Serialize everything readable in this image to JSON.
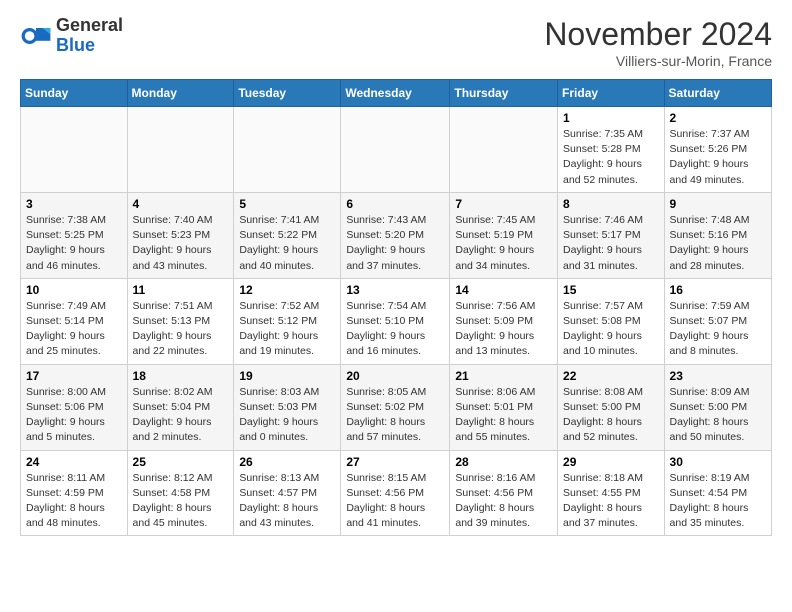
{
  "logo": {
    "text_general": "General",
    "text_blue": "Blue"
  },
  "title": "November 2024",
  "location": "Villiers-sur-Morin, France",
  "weekdays": [
    "Sunday",
    "Monday",
    "Tuesday",
    "Wednesday",
    "Thursday",
    "Friday",
    "Saturday"
  ],
  "weeks": [
    [
      {
        "day": "",
        "info": ""
      },
      {
        "day": "",
        "info": ""
      },
      {
        "day": "",
        "info": ""
      },
      {
        "day": "",
        "info": ""
      },
      {
        "day": "",
        "info": ""
      },
      {
        "day": "1",
        "info": "Sunrise: 7:35 AM\nSunset: 5:28 PM\nDaylight: 9 hours\nand 52 minutes."
      },
      {
        "day": "2",
        "info": "Sunrise: 7:37 AM\nSunset: 5:26 PM\nDaylight: 9 hours\nand 49 minutes."
      }
    ],
    [
      {
        "day": "3",
        "info": "Sunrise: 7:38 AM\nSunset: 5:25 PM\nDaylight: 9 hours\nand 46 minutes."
      },
      {
        "day": "4",
        "info": "Sunrise: 7:40 AM\nSunset: 5:23 PM\nDaylight: 9 hours\nand 43 minutes."
      },
      {
        "day": "5",
        "info": "Sunrise: 7:41 AM\nSunset: 5:22 PM\nDaylight: 9 hours\nand 40 minutes."
      },
      {
        "day": "6",
        "info": "Sunrise: 7:43 AM\nSunset: 5:20 PM\nDaylight: 9 hours\nand 37 minutes."
      },
      {
        "day": "7",
        "info": "Sunrise: 7:45 AM\nSunset: 5:19 PM\nDaylight: 9 hours\nand 34 minutes."
      },
      {
        "day": "8",
        "info": "Sunrise: 7:46 AM\nSunset: 5:17 PM\nDaylight: 9 hours\nand 31 minutes."
      },
      {
        "day": "9",
        "info": "Sunrise: 7:48 AM\nSunset: 5:16 PM\nDaylight: 9 hours\nand 28 minutes."
      }
    ],
    [
      {
        "day": "10",
        "info": "Sunrise: 7:49 AM\nSunset: 5:14 PM\nDaylight: 9 hours\nand 25 minutes."
      },
      {
        "day": "11",
        "info": "Sunrise: 7:51 AM\nSunset: 5:13 PM\nDaylight: 9 hours\nand 22 minutes."
      },
      {
        "day": "12",
        "info": "Sunrise: 7:52 AM\nSunset: 5:12 PM\nDaylight: 9 hours\nand 19 minutes."
      },
      {
        "day": "13",
        "info": "Sunrise: 7:54 AM\nSunset: 5:10 PM\nDaylight: 9 hours\nand 16 minutes."
      },
      {
        "day": "14",
        "info": "Sunrise: 7:56 AM\nSunset: 5:09 PM\nDaylight: 9 hours\nand 13 minutes."
      },
      {
        "day": "15",
        "info": "Sunrise: 7:57 AM\nSunset: 5:08 PM\nDaylight: 9 hours\nand 10 minutes."
      },
      {
        "day": "16",
        "info": "Sunrise: 7:59 AM\nSunset: 5:07 PM\nDaylight: 9 hours\nand 8 minutes."
      }
    ],
    [
      {
        "day": "17",
        "info": "Sunrise: 8:00 AM\nSunset: 5:06 PM\nDaylight: 9 hours\nand 5 minutes."
      },
      {
        "day": "18",
        "info": "Sunrise: 8:02 AM\nSunset: 5:04 PM\nDaylight: 9 hours\nand 2 minutes."
      },
      {
        "day": "19",
        "info": "Sunrise: 8:03 AM\nSunset: 5:03 PM\nDaylight: 9 hours\nand 0 minutes."
      },
      {
        "day": "20",
        "info": "Sunrise: 8:05 AM\nSunset: 5:02 PM\nDaylight: 8 hours\nand 57 minutes."
      },
      {
        "day": "21",
        "info": "Sunrise: 8:06 AM\nSunset: 5:01 PM\nDaylight: 8 hours\nand 55 minutes."
      },
      {
        "day": "22",
        "info": "Sunrise: 8:08 AM\nSunset: 5:00 PM\nDaylight: 8 hours\nand 52 minutes."
      },
      {
        "day": "23",
        "info": "Sunrise: 8:09 AM\nSunset: 5:00 PM\nDaylight: 8 hours\nand 50 minutes."
      }
    ],
    [
      {
        "day": "24",
        "info": "Sunrise: 8:11 AM\nSunset: 4:59 PM\nDaylight: 8 hours\nand 48 minutes."
      },
      {
        "day": "25",
        "info": "Sunrise: 8:12 AM\nSunset: 4:58 PM\nDaylight: 8 hours\nand 45 minutes."
      },
      {
        "day": "26",
        "info": "Sunrise: 8:13 AM\nSunset: 4:57 PM\nDaylight: 8 hours\nand 43 minutes."
      },
      {
        "day": "27",
        "info": "Sunrise: 8:15 AM\nSunset: 4:56 PM\nDaylight: 8 hours\nand 41 minutes."
      },
      {
        "day": "28",
        "info": "Sunrise: 8:16 AM\nSunset: 4:56 PM\nDaylight: 8 hours\nand 39 minutes."
      },
      {
        "day": "29",
        "info": "Sunrise: 8:18 AM\nSunset: 4:55 PM\nDaylight: 8 hours\nand 37 minutes."
      },
      {
        "day": "30",
        "info": "Sunrise: 8:19 AM\nSunset: 4:54 PM\nDaylight: 8 hours\nand 35 minutes."
      }
    ]
  ]
}
